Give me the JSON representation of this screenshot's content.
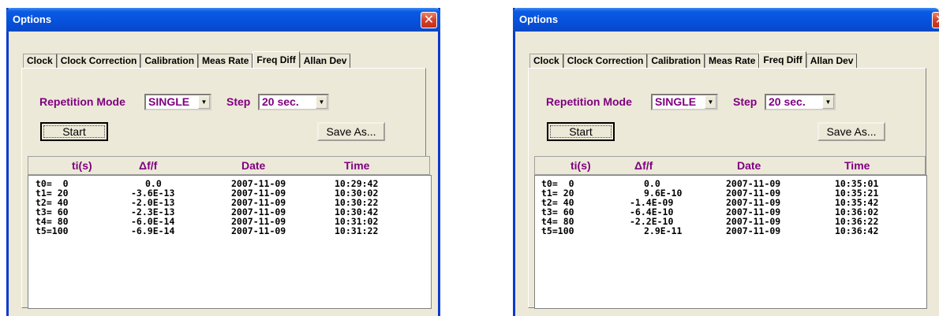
{
  "dialogs": [
    {
      "title": "Options",
      "tabs": [
        "Clock",
        "Clock Correction",
        "Calibration",
        "Meas Rate",
        "Freq Diff",
        "Allan Dev"
      ],
      "active_tab": "Freq Diff",
      "repetition_label": "Repetition Mode",
      "repetition_value": "SINGLE",
      "step_label": "Step",
      "step_value": "20 sec.",
      "start_label": "Start",
      "save_label": "Save As...",
      "columns": [
        "ti(s)",
        "Δf/f",
        "Date",
        "Time"
      ],
      "rows": [
        [
          "t0=  0",
          "0.0",
          "2007-11-09",
          "10:29:42"
        ],
        [
          "t1= 20",
          "-3.6E-13",
          "2007-11-09",
          "10:30:02"
        ],
        [
          "t2= 40",
          "-2.0E-13",
          "2007-11-09",
          "10:30:22"
        ],
        [
          "t3= 60",
          "-2.3E-13",
          "2007-11-09",
          "10:30:42"
        ],
        [
          "t4= 80",
          "-6.0E-14",
          "2007-11-09",
          "10:31:02"
        ],
        [
          "t5=100",
          "-6.9E-14",
          "2007-11-09",
          "10:31:22"
        ]
      ]
    },
    {
      "title": "Options",
      "tabs": [
        "Clock",
        "Clock Correction",
        "Calibration",
        "Meas Rate",
        "Freq Diff",
        "Allan Dev"
      ],
      "active_tab": "Freq Diff",
      "repetition_label": "Repetition Mode",
      "repetition_value": "SINGLE",
      "step_label": "Step",
      "step_value": "20 sec.",
      "start_label": "Start",
      "save_label": "Save As...",
      "columns": [
        "ti(s)",
        "Δf/f",
        "Date",
        "Time"
      ],
      "rows": [
        [
          "t0=  0",
          "0.0",
          "2007-11-09",
          "10:35:01"
        ],
        [
          "t1= 20",
          "9.6E-10",
          "2007-11-09",
          "10:35:21"
        ],
        [
          "t2= 40",
          "-1.4E-09",
          "2007-11-09",
          "10:35:42"
        ],
        [
          "t3= 60",
          "-6.4E-10",
          "2007-11-09",
          "10:36:02"
        ],
        [
          "t4= 80",
          "-2.2E-10",
          "2007-11-09",
          "10:36:22"
        ],
        [
          "t5=100",
          "2.9E-11",
          "2007-11-09",
          "10:36:42"
        ]
      ]
    }
  ],
  "icons": {
    "close": "close-x-icon",
    "dropdown": "dropdown-arrow-icon"
  },
  "colors": {
    "title_bar": "#0550dc",
    "label_purple": "#800080",
    "close_red": "#d4402a",
    "face": "#ece9d8"
  }
}
